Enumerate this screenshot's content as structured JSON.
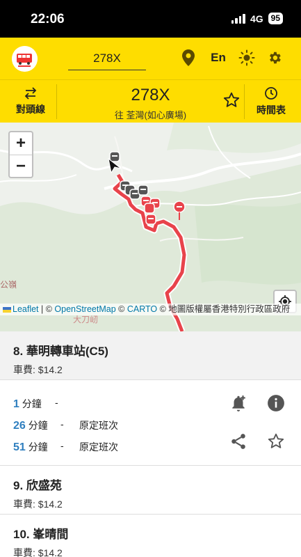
{
  "status": {
    "time": "22:06",
    "network": "4G",
    "battery": "95"
  },
  "header": {
    "search_value": "278X",
    "lang_label": "En"
  },
  "route": {
    "reverse_label": "對頭線",
    "number": "278X",
    "destination": "往 荃灣(如心廣場)",
    "timetable_label": "時間表"
  },
  "map": {
    "zoom_in": "+",
    "zoom_out": "−",
    "place_label_1": "公嶺",
    "place_label_2": "大刀屻",
    "attribution": {
      "leaflet": "Leaflet",
      "sep1": " | © ",
      "osm": "OpenStreetMap",
      "sep2": " © ",
      "carto": "CARTO",
      "gov": " © 地圖版權屬香港特別行政區政府"
    }
  },
  "stops": [
    {
      "name": "8. 華明轉車站(C5)",
      "fare": "車費: $14.2"
    },
    {
      "name": "9. 欣盛苑",
      "fare": "車費: $14.2"
    },
    {
      "name": "10. 峯晴間",
      "fare": "車費: $14.2"
    }
  ],
  "eta": [
    {
      "minutes": "1",
      "unit": "分鐘",
      "dash": "-",
      "remark": ""
    },
    {
      "minutes": "26",
      "unit": "分鐘",
      "dash": "-",
      "remark": "原定班次"
    },
    {
      "minutes": "51",
      "unit": "分鐘",
      "dash": "-",
      "remark": "原定班次"
    }
  ],
  "colors": {
    "brand_yellow": "#fedd00",
    "route_red": "#e8434b",
    "eta_blue": "#2f7fbf"
  }
}
